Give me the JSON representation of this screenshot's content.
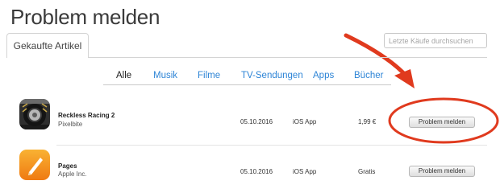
{
  "page": {
    "title": "Problem melden"
  },
  "tabs": [
    {
      "label": "Gekaufte Artikel"
    }
  ],
  "search": {
    "placeholder": "Letzte Käufe durchsuchen",
    "value": ""
  },
  "filters": [
    {
      "label": "Alle",
      "active": true
    },
    {
      "label": "Musik"
    },
    {
      "label": "Filme"
    },
    {
      "label": "TV-Sendungen"
    },
    {
      "label": "Apps"
    },
    {
      "label": "Bücher"
    }
  ],
  "purchases": [
    {
      "name": "Reckless Racing 2",
      "developer": "Pixelbite",
      "date": "05.10.2016",
      "kind": "iOS App",
      "price": "1,99 €",
      "action": "Problem melden",
      "icon": "reckless-racing-2-app-icon"
    },
    {
      "name": "Pages",
      "developer": "Apple Inc.",
      "date": "05.10.2016",
      "kind": "iOS App",
      "price": "Gratis",
      "action": "Problem melden",
      "icon": "pages-app-icon"
    }
  ],
  "annotation": {
    "color": "#e03a1e"
  },
  "colors": {
    "link": "#2d84d6",
    "divider": "#c9c9c9"
  }
}
